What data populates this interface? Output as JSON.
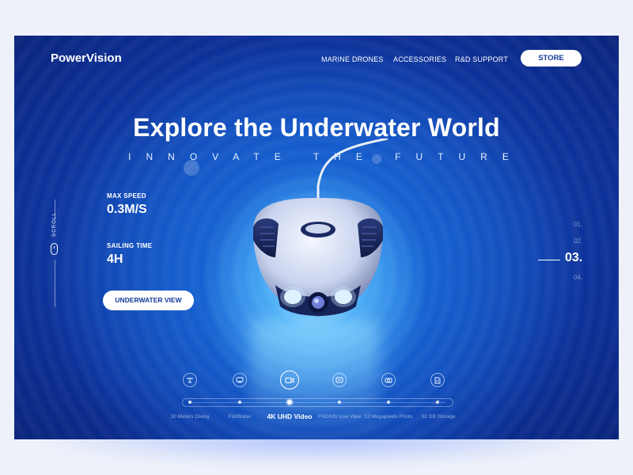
{
  "brand": {
    "name": "PowerVision"
  },
  "nav": {
    "items": [
      {
        "label": "MARINE DRONES"
      },
      {
        "label": "ACCESSORIES"
      },
      {
        "label": "R&D SUPPORT"
      }
    ],
    "store_label": "STORE"
  },
  "hero": {
    "title": "Explore the Underwater World",
    "tagline": "INNOVATE THE FUTURE",
    "cta_label": "UNDERWATER VIEW"
  },
  "stats": [
    {
      "label": "MAX  SPEED",
      "value": "0.3M/S"
    },
    {
      "label": "SAILING TIME",
      "value": "4H"
    }
  ],
  "scroll": {
    "label": "SCROLL",
    "icon": "mouse-icon"
  },
  "slides": {
    "items": [
      "01.",
      "02.",
      "03.",
      "04."
    ],
    "active": "03."
  },
  "features": [
    {
      "label": "30 Meters Diving",
      "icon": "diving-icon",
      "active": false
    },
    {
      "label": "Fishfinder",
      "icon": "fishfinder-icon",
      "active": false
    },
    {
      "label": "4K UHD Video",
      "icon": "video-camera-icon",
      "active": true
    },
    {
      "label": "FHD/HD Live View",
      "icon": "live-view-icon",
      "active": false
    },
    {
      "label": "12 Megapixels Photo",
      "icon": "camera-icon",
      "active": false
    },
    {
      "label": "32 GB Storage",
      "icon": "storage-icon",
      "active": false
    }
  ],
  "colors": {
    "accent": "#123b9a",
    "background": "#0c2f97",
    "highlight": "#4fb0f7"
  }
}
